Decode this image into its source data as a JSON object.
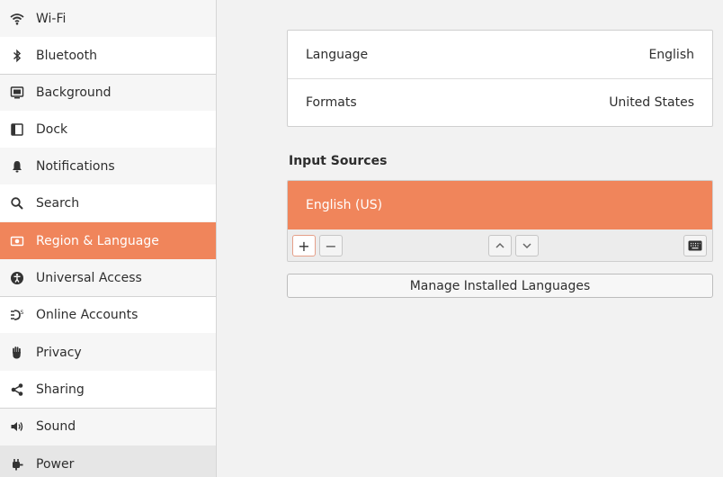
{
  "sidebar": {
    "items": [
      {
        "label": "Wi-Fi",
        "icon": "wifi-icon"
      },
      {
        "label": "Bluetooth",
        "icon": "bluetooth-icon"
      },
      {
        "label": "Background",
        "icon": "background-icon"
      },
      {
        "label": "Dock",
        "icon": "dock-icon"
      },
      {
        "label": "Notifications",
        "icon": "bell-icon"
      },
      {
        "label": "Search",
        "icon": "search-icon"
      },
      {
        "label": "Region & Language",
        "icon": "region-icon"
      },
      {
        "label": "Universal Access",
        "icon": "accessibility-icon"
      },
      {
        "label": "Online Accounts",
        "icon": "online-accounts-icon"
      },
      {
        "label": "Privacy",
        "icon": "hand-icon"
      },
      {
        "label": "Sharing",
        "icon": "share-icon"
      },
      {
        "label": "Sound",
        "icon": "speaker-icon"
      },
      {
        "label": "Power",
        "icon": "power-plug-icon"
      }
    ],
    "active": "Region & Language"
  },
  "main": {
    "language": {
      "label": "Language",
      "value": "English"
    },
    "formats": {
      "label": "Formats",
      "value": "United States"
    },
    "input_sources": {
      "title": "Input Sources",
      "items": [
        "English (US)"
      ],
      "add_label": "+",
      "remove_label": "−"
    },
    "manage_button": "Manage Installed Languages"
  },
  "colors": {
    "accent": "#f0855b",
    "sidebar_bg": "#f6f6f6",
    "content_bg": "#f2f2f2"
  }
}
